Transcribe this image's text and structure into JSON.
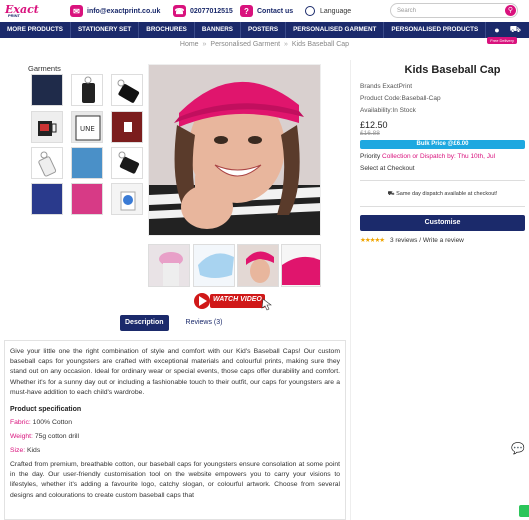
{
  "brand": {
    "logo_main": "Exact",
    "logo_sub": "PRINT"
  },
  "topbar": {
    "email": "info@exactprint.co.uk",
    "phone": "02077012515",
    "contact": "Contact us",
    "language": "Language",
    "search_placeholder": "Search"
  },
  "nav": {
    "items": [
      "MORE PRODUCTS",
      "STATIONERY SET",
      "BROCHURES",
      "BANNERS",
      "POSTERS",
      "PERSONALISED GARMENT",
      "PERSONALISED PRODUCTS"
    ],
    "free_delivery": "Free Delivery"
  },
  "breadcrumb": {
    "items": [
      "Home",
      "Personalised Garment",
      "Kids Baseball Cap"
    ],
    "sep": "»"
  },
  "gallery": {
    "category": "Garments",
    "watch_video": "WATCH VIDEO"
  },
  "tabs": {
    "description": "Description",
    "reviews": "Reviews (3)"
  },
  "product": {
    "title": "Kids Baseball Cap",
    "brand": "Brands ExactPrint",
    "code": "Product Code:Baseball-Cap",
    "availability": "Availability:In Stock",
    "price": "£12.50",
    "old_price": "£16.88",
    "bulk": "Bulk Price @£6.00",
    "priority_label": "Priority",
    "priority_value": "Collection or Dispatch by: Thu 10th, Jul",
    "select_checkout": "Select at Checkout",
    "dispatch": "Same day dispatch available at checkout!",
    "customise": "Customise",
    "reviews": "3 reviews / Write a review",
    "rating_stars": 5
  },
  "description": {
    "intro": "Give your little one the right combination of style and comfort with our Kid's Baseball Caps! Our custom baseball caps for youngsters are crafted with exceptional materials and colourful prints, making sure they stand out on any occasion. Ideal for ordinary wear or special events, those caps offer durability and comfort. Whether it's for a sunny day out or including a fashionable touch to their outfit, our caps for youngsters are a must-have addition to each child's wardrobe.",
    "spec_heading": "Product specification",
    "fabric_label": "Fabric:",
    "fabric": "100% Cotton",
    "weight_label": "Weight:",
    "weight": "75g cotton drill",
    "size_label": "Size:",
    "size": "Kids",
    "more": "Crafted from premium, breathable cotton, our baseball caps for youngsters ensure consolation at some point in the day. Our user-friendly customisation tool on the website empowers you to carry your visions to lifestyles, whether it's adding a favourite logo, catchy slogan, or colourful artwork. Choose from several designs and colourations to create custom baseball caps that"
  },
  "colors": {
    "navy": "#1b2a6b",
    "pink": "#d9127d",
    "blue": "#1ea8e0"
  }
}
